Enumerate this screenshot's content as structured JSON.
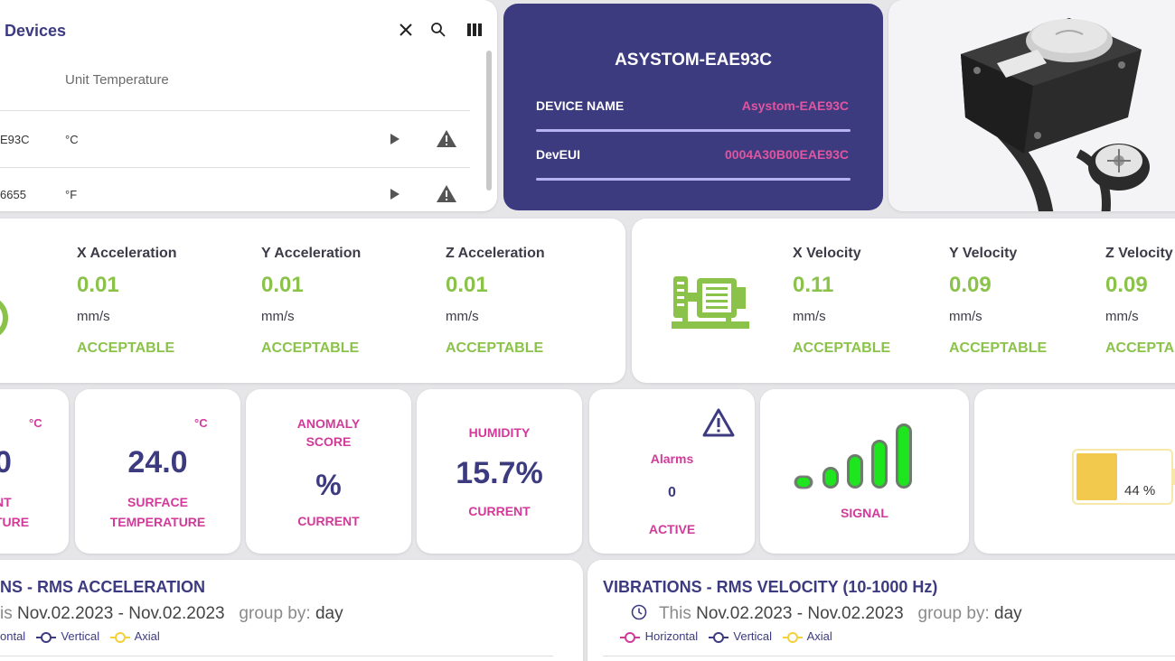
{
  "devices": {
    "title": "Devices",
    "column_unit_temperature": "Unit Temperature",
    "rows": [
      {
        "name": "E93C",
        "unit": "°C"
      },
      {
        "name": "6655",
        "unit": "°F"
      }
    ],
    "icons": [
      "close-icon",
      "search-icon",
      "columns-icon",
      "play-icon",
      "warning-icon"
    ]
  },
  "device_header": {
    "title": "ASYSTOM-EAE93C",
    "name_label": "DEVICE NAME",
    "name_value": "Asystom-EAE93C",
    "deveui_label": "DevEUI",
    "deveui_value": "0004A30B00EAE93C"
  },
  "acceleration": {
    "items": [
      {
        "label": "X Acceleration",
        "value": "0.01",
        "unit": "mm/s",
        "status": "ACCEPTABLE"
      },
      {
        "label": "Y Acceleration",
        "value": "0.01",
        "unit": "mm/s",
        "status": "ACCEPTABLE"
      },
      {
        "label": "Z Acceleration",
        "value": "0.01",
        "unit": "mm/s",
        "status": "ACCEPTABLE"
      }
    ]
  },
  "velocity": {
    "items": [
      {
        "label": "X Velocity",
        "value": "0.11",
        "unit": "mm/s",
        "status": "ACCEPTABLE"
      },
      {
        "label": "Y Velocity",
        "value": "0.09",
        "unit": "mm/s",
        "status": "ACCEPTABLE"
      },
      {
        "label": "Z Velocity",
        "value": "0.09",
        "unit": "mm/s",
        "status": "ACCEPTA"
      }
    ]
  },
  "tiles": {
    "ambient": {
      "unit": "°C",
      "value": "0",
      "cap1": "NT",
      "cap2": "TURE"
    },
    "surface": {
      "unit": "°C",
      "value": "24.0",
      "cap1": "SURFACE",
      "cap2": "TEMPERATURE"
    },
    "anomaly": {
      "title1": "ANOMALY",
      "title2": "SCORE",
      "value": "%",
      "cap": "CURRENT"
    },
    "humidity": {
      "title": "HUMIDITY",
      "value": "15.7%",
      "cap": "CURRENT"
    },
    "alarms": {
      "title": "Alarms",
      "value": "0",
      "cap": "ACTIVE"
    },
    "signal": {
      "cap": "SIGNAL",
      "level_bars": 5
    },
    "battery": {
      "text": "44 %",
      "level": 0.44
    }
  },
  "charts": [
    {
      "title": "NS - RMS ACCELERATION",
      "period_prefix": "is",
      "period": "Nov.02.2023 - Nov.02.2023",
      "group_label": "group by:",
      "group_value": "day",
      "legend": [
        "ontal",
        "Vertical",
        "Axial"
      ]
    },
    {
      "title": "VIBRATIONS - RMS VELOCITY (10-1000 Hz)",
      "period_prefix": "This",
      "period": "Nov.02.2023 - Nov.02.2023",
      "group_label": "group by:",
      "group_value": "day",
      "legend": [
        "Horizontal",
        "Vertical",
        "Axial"
      ]
    }
  ],
  "colors": {
    "brand": "#3d3b80",
    "accent_pink": "#d23a9a",
    "good_green": "#8bc34a",
    "signal_green": "#1ee51e",
    "battery_yellow": "#f2c94c"
  }
}
